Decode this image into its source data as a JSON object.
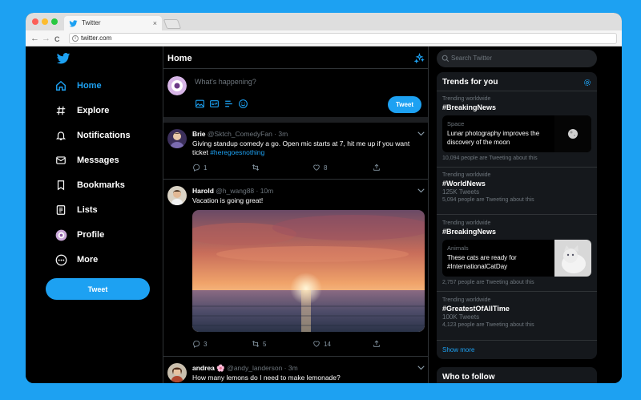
{
  "browser": {
    "tab_title": "Twitter",
    "tab_close": "×",
    "url": "twitter.com",
    "back": "←",
    "forward": "→",
    "reload": "C",
    "info": "i"
  },
  "nav": {
    "items": [
      {
        "label": "Home",
        "icon": "home-icon",
        "active": true
      },
      {
        "label": "Explore",
        "icon": "hashtag-icon"
      },
      {
        "label": "Notifications",
        "icon": "bell-icon"
      },
      {
        "label": "Messages",
        "icon": "envelope-icon"
      },
      {
        "label": "Bookmarks",
        "icon": "bookmark-icon"
      },
      {
        "label": "Lists",
        "icon": "list-icon"
      },
      {
        "label": "Profile",
        "icon": "avatar-icon"
      },
      {
        "label": "More",
        "icon": "more-icon"
      }
    ],
    "tweet_label": "Tweet"
  },
  "feed": {
    "title": "Home",
    "compose_placeholder": "What's happening?",
    "compose_tweet_label": "Tweet",
    "tweets": [
      {
        "name": "Brie",
        "handle": "@Sktch_ComedyFan · 3m",
        "text": "Giving standup comedy a go. Open mic starts at 7, hit me up if you want ticket ",
        "hashtag": "#heregoesnothing",
        "replies": "1",
        "retweets": "",
        "likes": "8"
      },
      {
        "name": "Harold",
        "handle": "@h_wang88 · 10m",
        "text": "Vacation is going great!",
        "replies": "3",
        "retweets": "5",
        "likes": "14"
      },
      {
        "name": "andrea 🌸",
        "handle": "@andy_landerson · 3m",
        "text": "How many lemons do I need to make lemonade?"
      }
    ]
  },
  "sidebar": {
    "search_placeholder": "Search Twitter",
    "trends_title": "Trends for you",
    "trends": [
      {
        "context": "Trending worldwide",
        "title": "#BreakingNews"
      },
      {
        "card_context": "Space",
        "card_text": "Lunar photography improves the discovery of the moon",
        "count": "10,094 people are Tweeting about this"
      },
      {
        "context": "Trending worldwide",
        "title": "#WorldNews",
        "tweets": "125K Tweets",
        "count": "5,094 people are Tweeting about this"
      },
      {
        "context": "Trending worldwide",
        "title": "#BreakingNews"
      },
      {
        "card_context": "Animals",
        "card_text": "These cats are ready for #InternationalCatDay",
        "count": "2,757 people are Tweeting about this"
      },
      {
        "context": "Trending worldwide",
        "title": "#GreatestOfAllTime",
        "tweets": "100K Tweets",
        "count": "4,123 people are Tweeting about this"
      }
    ],
    "show_more": "Show more",
    "who_to_follow": "Who to follow"
  },
  "colors": {
    "accent": "#1DA1F2",
    "background": "#000000",
    "panel": "#15181c"
  }
}
